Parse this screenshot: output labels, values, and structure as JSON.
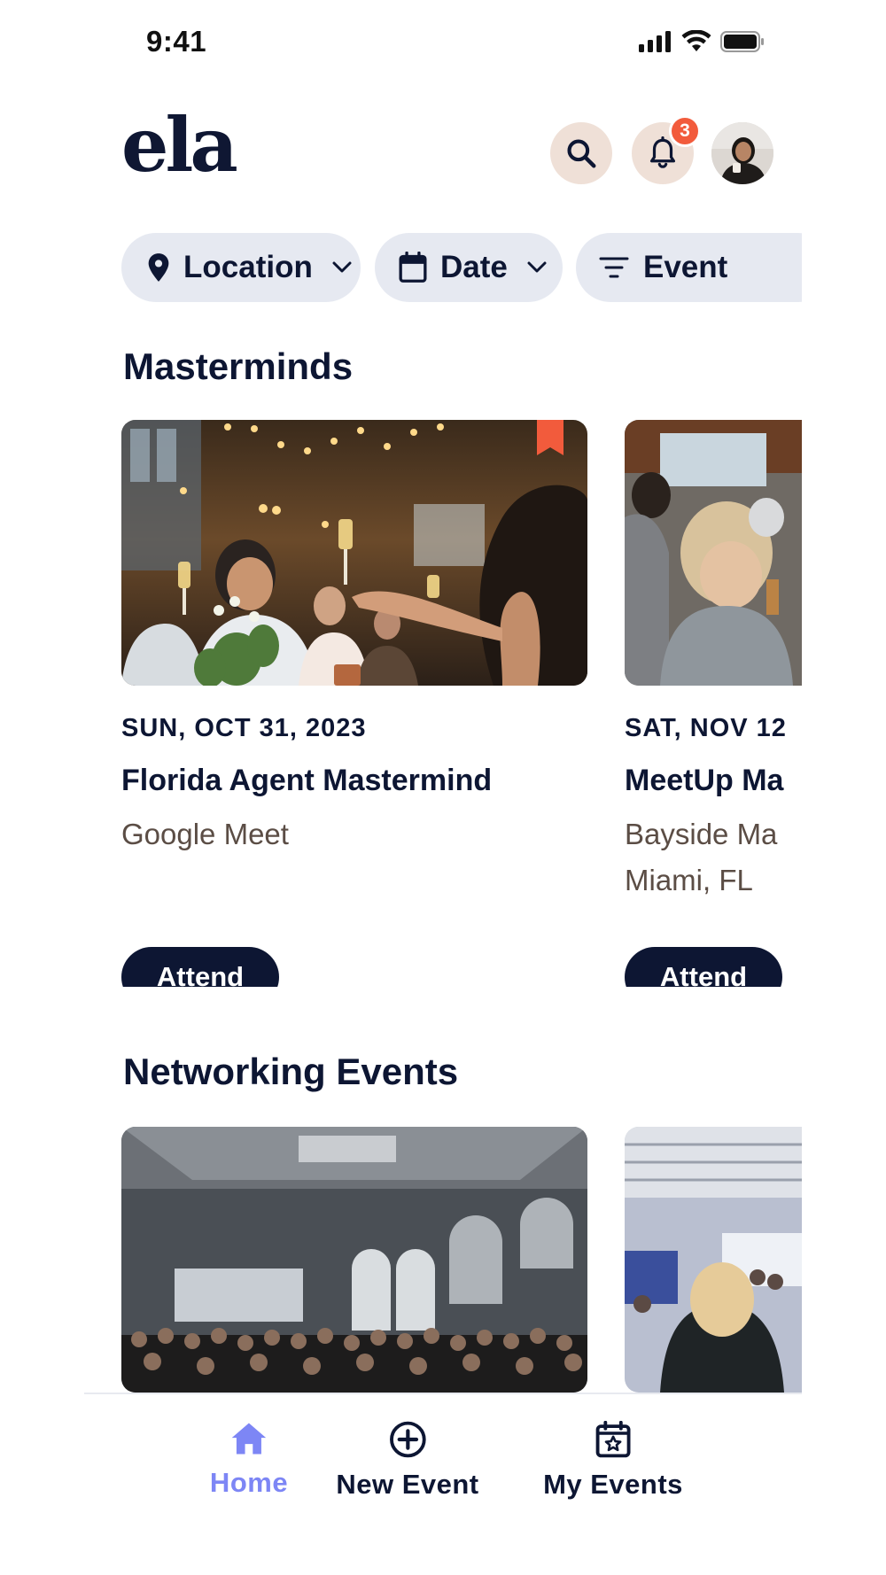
{
  "status_bar": {
    "time": "9:41"
  },
  "header": {
    "logo": "ela",
    "notification_count": "3",
    "icons": {
      "search": "search-icon",
      "bell": "bell-icon",
      "avatar": "avatar"
    }
  },
  "filters": [
    {
      "label": "Location",
      "icon": "location-pin-icon"
    },
    {
      "label": "Date",
      "icon": "calendar-icon"
    },
    {
      "label": "Event",
      "icon": "filter-icon"
    }
  ],
  "sections": {
    "masterminds": {
      "title": "Masterminds",
      "cards": [
        {
          "date": "SUN, OCT 31, 2023",
          "title": "Florida Agent Mastermind",
          "location_line1": "Google Meet",
          "location_line2": "",
          "button": "Attend",
          "bookmarked": true
        },
        {
          "date": "SAT, NOV 12",
          "title": "MeetUp Ma",
          "location_line1": "Bayside Ma",
          "location_line2": "Miami, FL",
          "button": "Attend",
          "bookmarked": false
        }
      ]
    },
    "networking": {
      "title": "Networking Events"
    }
  },
  "tabbar": [
    {
      "label": "Home",
      "icon": "home-icon",
      "active": true
    },
    {
      "label": "New Event",
      "icon": "plus-circle-icon",
      "active": false
    },
    {
      "label": "My Events",
      "icon": "calendar-star-icon",
      "active": false
    }
  ],
  "colors": {
    "primary": "#0d1633",
    "accent": "#7d86f5",
    "badge": "#f25b3c",
    "chip_bg": "#e6e9f1",
    "icon_button_bg": "#efe0d7"
  }
}
